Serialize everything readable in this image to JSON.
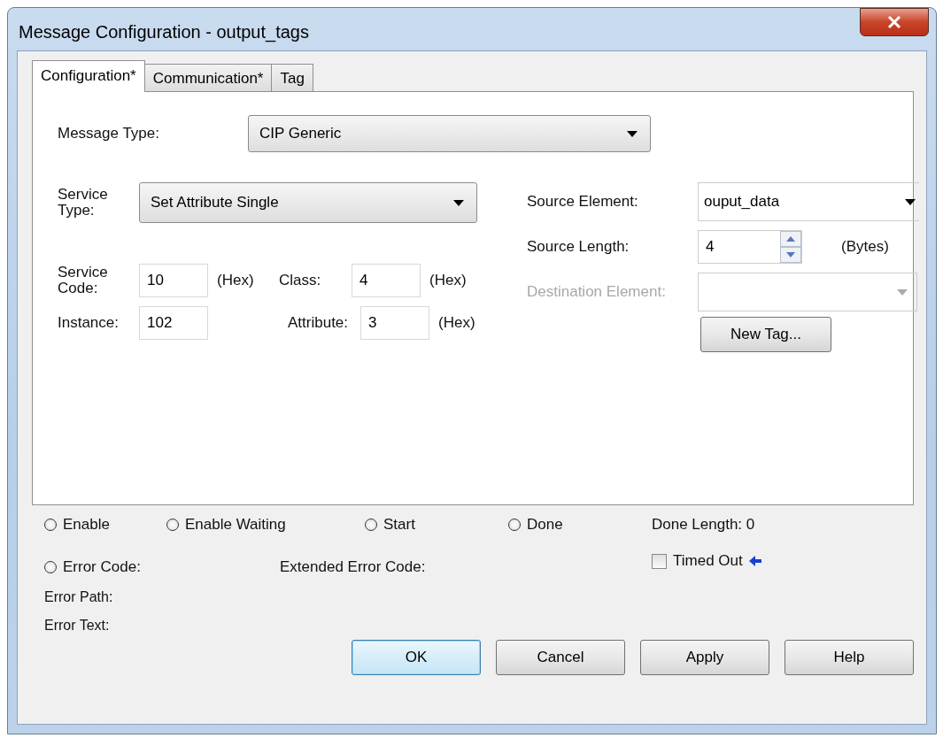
{
  "window": {
    "title": "Message Configuration - output_tags"
  },
  "tabs": [
    {
      "label": "Configuration*",
      "selected": true
    },
    {
      "label": "Communication*",
      "selected": false
    },
    {
      "label": "Tag",
      "selected": false
    }
  ],
  "message_type": {
    "label": "Message Type:",
    "value": "CIP Generic"
  },
  "service_type": {
    "label": "Service Type:",
    "value": "Set Attribute Single"
  },
  "service_code": {
    "label": "Service Code:",
    "value": "10",
    "unit": "(Hex)"
  },
  "class": {
    "label": "Class:",
    "value": "4",
    "unit": "(Hex)"
  },
  "instance": {
    "label": "Instance:",
    "value": "102"
  },
  "attribute": {
    "label": "Attribute:",
    "value": "3",
    "unit": "(Hex)"
  },
  "source_element": {
    "label": "Source Element:",
    "value": "ouput_data"
  },
  "source_length": {
    "label": "Source Length:",
    "value": "4",
    "unit": "(Bytes)"
  },
  "destination_element": {
    "label": "Destination Element:",
    "disabled": true
  },
  "new_tag_button": "New Tag...",
  "status_flags": [
    {
      "label": "Enable",
      "checked": false
    },
    {
      "label": "Enable Waiting",
      "checked": false
    },
    {
      "label": "Start",
      "checked": false
    },
    {
      "label": "Done",
      "checked": false
    }
  ],
  "done_length": "Done Length:  0",
  "error_code": {
    "label": "Error Code:",
    "checked": false
  },
  "extended_error_code": "Extended Error Code:",
  "timed_out": {
    "label": "Timed Out",
    "checked": false
  },
  "error_path": "Error Path:",
  "error_text": "Error Text:",
  "buttons": [
    {
      "label": "OK",
      "default": true
    },
    {
      "label": "Cancel",
      "default": false
    },
    {
      "label": "Apply",
      "default": false
    },
    {
      "label": "Help",
      "default": false
    }
  ]
}
